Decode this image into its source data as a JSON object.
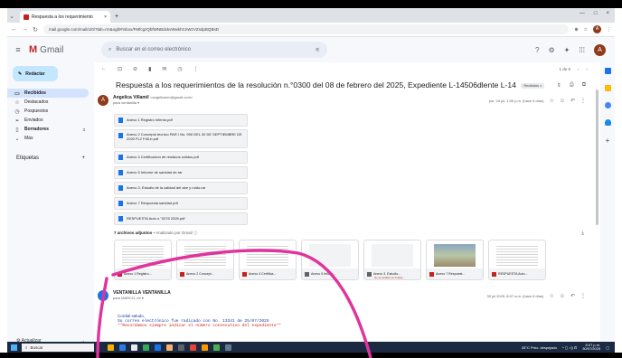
{
  "browser": {
    "tab_title": "Respuesta a los requerimiento",
    "tab_close": "×",
    "new_tab": "+",
    "url": "mail.google.com/mail/u/0/?tab=rm&ogbl#inbox/FMfcgzQbfWNBdxkvWwkhCnWzVZsdpBQBsD",
    "win_controls": [
      "—",
      "□",
      "×"
    ]
  },
  "gmail": {
    "app_name": "Gmail",
    "search_placeholder": "Buscar en el correo electrónico",
    "avatar_letter": "A"
  },
  "sidebar": {
    "compose_label": "Redactar",
    "items": [
      {
        "label": "Recibidos",
        "icon": "inbox-icon",
        "count": "",
        "active": true
      },
      {
        "label": "Destacados",
        "icon": "star-icon",
        "count": ""
      },
      {
        "label": "Pospuestos",
        "icon": "clock-icon",
        "count": ""
      },
      {
        "label": "Enviados",
        "icon": "send-icon",
        "count": ""
      },
      {
        "label": "Borradores",
        "icon": "draft-icon",
        "count": "3"
      },
      {
        "label": "Más",
        "icon": "chevron-down-icon",
        "count": ""
      }
    ],
    "labels_title": "Etiquetas",
    "labels_add": "+",
    "activate_label": "Actualizar",
    "activate_arrow": "→"
  },
  "toolbar": {
    "pager": "1 de 6",
    "prev": "‹",
    "next": "›"
  },
  "thread": {
    "subject": "Respuesta a los requerimientos de la resolución n.°0300 del 08 de febrero del 2025, Expediente L-14506dlente L-14",
    "badge": "Recibidos ×"
  },
  "message1": {
    "avatar_letter": "A",
    "sender_name": "Angelica Villamil",
    "sender_email": "<angelicavm@gmail.com>",
    "to": "para ventanilla ▾",
    "date": "jue, 24 jul, 1:00 p.m. (hace 6 días)",
    "attachments": [
      {
        "name": "Anexo 1 Registro Inferior.pdf",
        "tall": false
      },
      {
        "name": "Anexo 2 Concepto tecnico PAR I No. 990 DEL 30 DE SEPTIEMBRE DE 2020 FL2 F45-b.pdf",
        "tall": true
      },
      {
        "name": "Anexo 4 Certificacion de residuos solidos.pdf",
        "tall": false
      },
      {
        "name": "Anexo 5 Informe de sanidad de.rar",
        "tall": false
      },
      {
        "name": "Anexo 3. Estudio de la calidad del aire y ruido.rar",
        "tall": false
      },
      {
        "name": "Anexo 7 Respuesta sanidad.pdf",
        "tall": false
      },
      {
        "name": "RESPUESTA Auto n.°0078 2025.pdf",
        "tall": false
      }
    ]
  },
  "attachments_bar": {
    "count_label": "7 archivos adjuntos",
    "scanned": "• Analizado por Gmail ⓘ",
    "thumbs": [
      {
        "label": "Anexo 1 Registro...",
        "kind": "lines",
        "type": "pdf",
        "sub": ""
      },
      {
        "label": "Anexo 2 Concept...",
        "kind": "lines",
        "type": "pdf",
        "sub": ""
      },
      {
        "label": "Anexo 4 Certifica...",
        "kind": "lines",
        "type": "pdf",
        "sub": ""
      },
      {
        "label": "Anexo 5 Inform...",
        "kind": "blank",
        "type": "doc",
        "sub": ""
      },
      {
        "label": "Anexo 3. Estudio...",
        "kind": "blank",
        "type": "doc",
        "sub": "No se analizó en busca..."
      },
      {
        "label": "Anexo 7 Respuest...",
        "kind": "photo",
        "type": "pdf",
        "sub": ""
      },
      {
        "label": "RESPUESTA Auto...",
        "kind": "lines",
        "type": "pdf",
        "sub": ""
      }
    ]
  },
  "message2": {
    "sender_name": "VENTANILLA VENTANILLA",
    "to": "para MARCO, mí ▾",
    "date": "30 jul 2025, 8:07 a.m. (hace 6 días)",
    "greeting": "Cordial saludo,",
    "line1": "Su correo electrónico fue radicado con No. 13341 de 25/07/2025",
    "line2": "**Recordamos siempre indicar el número consecutivo del expediente**"
  },
  "taskbar": {
    "search_placeholder": "Buscar",
    "weather": "26°C Prec. despejado",
    "time": "8:07 p.m.",
    "date": "30/07/2025",
    "icon_colors": [
      "#f4b400",
      "#2d7be5",
      "#e8eaed",
      "#34a853",
      "#1a73e8",
      "#f6b26b",
      "#5f6368",
      "#ea4335",
      "#ff9800",
      "#4caf50",
      "#607d8b"
    ]
  },
  "annotation": {
    "color": "#e0339d"
  }
}
